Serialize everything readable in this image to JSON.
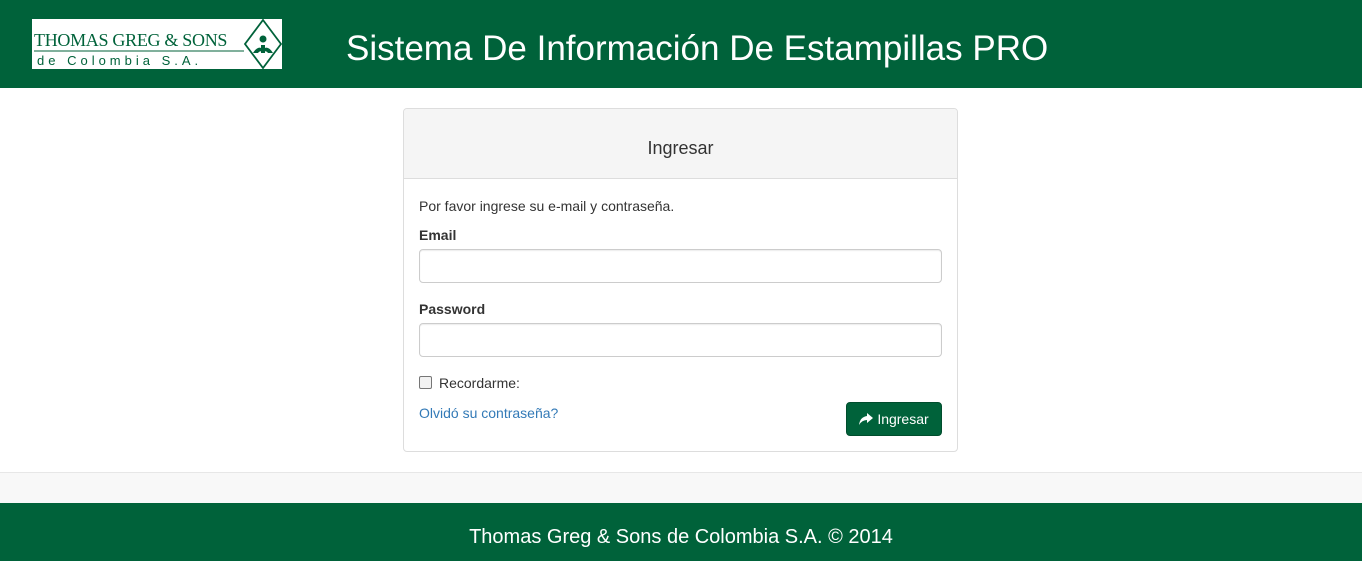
{
  "header": {
    "logo": {
      "line1": "THOMAS GREG & SONS",
      "line2": "de Colombia S.A."
    },
    "title": "Sistema De Información De Estampillas PRO"
  },
  "login_panel": {
    "title": "Ingresar",
    "instructions": "Por favor ingrese su e-mail y contraseña.",
    "email": {
      "label": "Email",
      "value": "",
      "placeholder": ""
    },
    "password": {
      "label": "Password",
      "value": "",
      "placeholder": ""
    },
    "remember": {
      "label": "Recordarme:",
      "checked": false
    },
    "forgot_link": "Olvidó su contraseña?",
    "submit": {
      "label": "Ingresar",
      "icon": "share-arrow-icon"
    }
  },
  "footer": {
    "text": "Thomas Greg & Sons de Colombia S.A. © 2014"
  },
  "colors": {
    "brand_green": "#00623a",
    "link_blue": "#337ab7",
    "panel_heading_bg": "#f5f5f5"
  }
}
